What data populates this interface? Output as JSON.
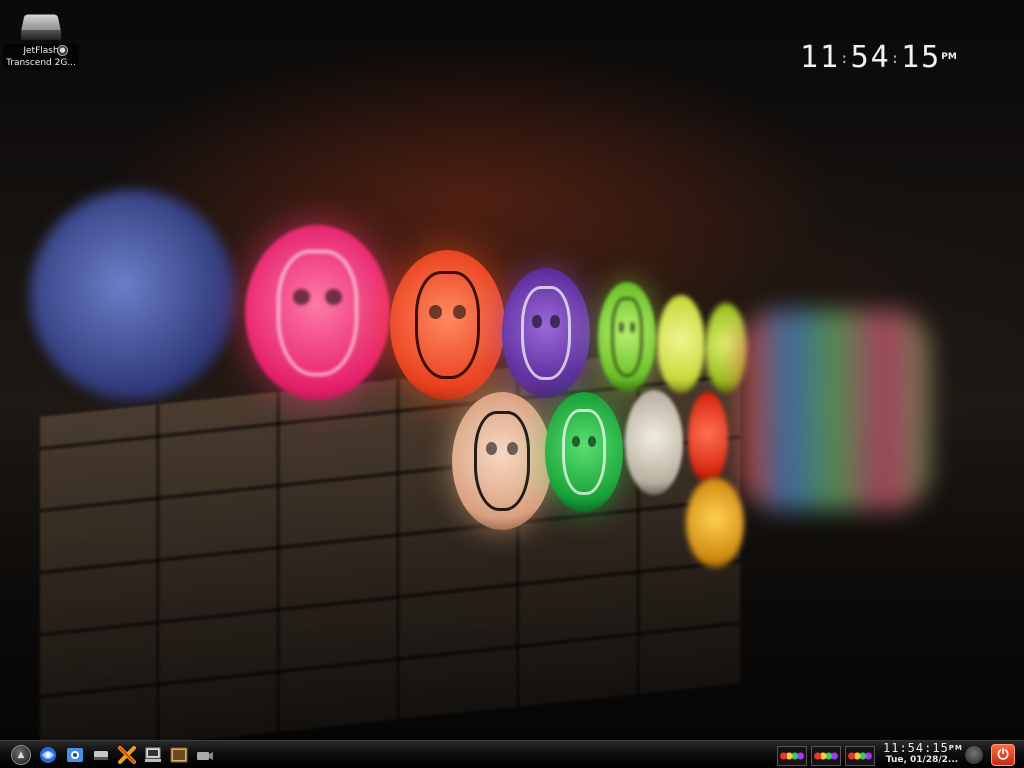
{
  "desktop": {
    "wallpaper": "glowing-mask-lanterns-on-brick-wall",
    "icons": [
      {
        "icon": "usb-drive-icon",
        "label_line1": "JetFlash",
        "label_line2": "Transcend 2G..."
      }
    ]
  },
  "clock_widget": {
    "hours": "11",
    "minutes": "54",
    "seconds": "15",
    "ampm": "PM"
  },
  "taskbar": {
    "launchers": [
      {
        "icon": "kmenu-icon"
      },
      {
        "icon": "konqueror-icon"
      },
      {
        "icon": "network-icon"
      },
      {
        "icon": "drive-icon"
      },
      {
        "icon": "crossover-icon"
      },
      {
        "icon": "computer-icon"
      },
      {
        "icon": "image-viewer-icon"
      },
      {
        "icon": "camera-icon"
      }
    ],
    "desktop_pager": [
      {
        "icon": "desktop-1-thumbnail"
      },
      {
        "icon": "desktop-2-thumbnail"
      },
      {
        "icon": "desktop-3-thumbnail"
      }
    ],
    "tray_clock": {
      "time": "11:54:15",
      "ampm": "PM",
      "date": "Tue, 01/28/2..."
    },
    "user_icon": "user-face-icon",
    "power_icon": "power-icon",
    "accent_color": "#e8421c"
  }
}
